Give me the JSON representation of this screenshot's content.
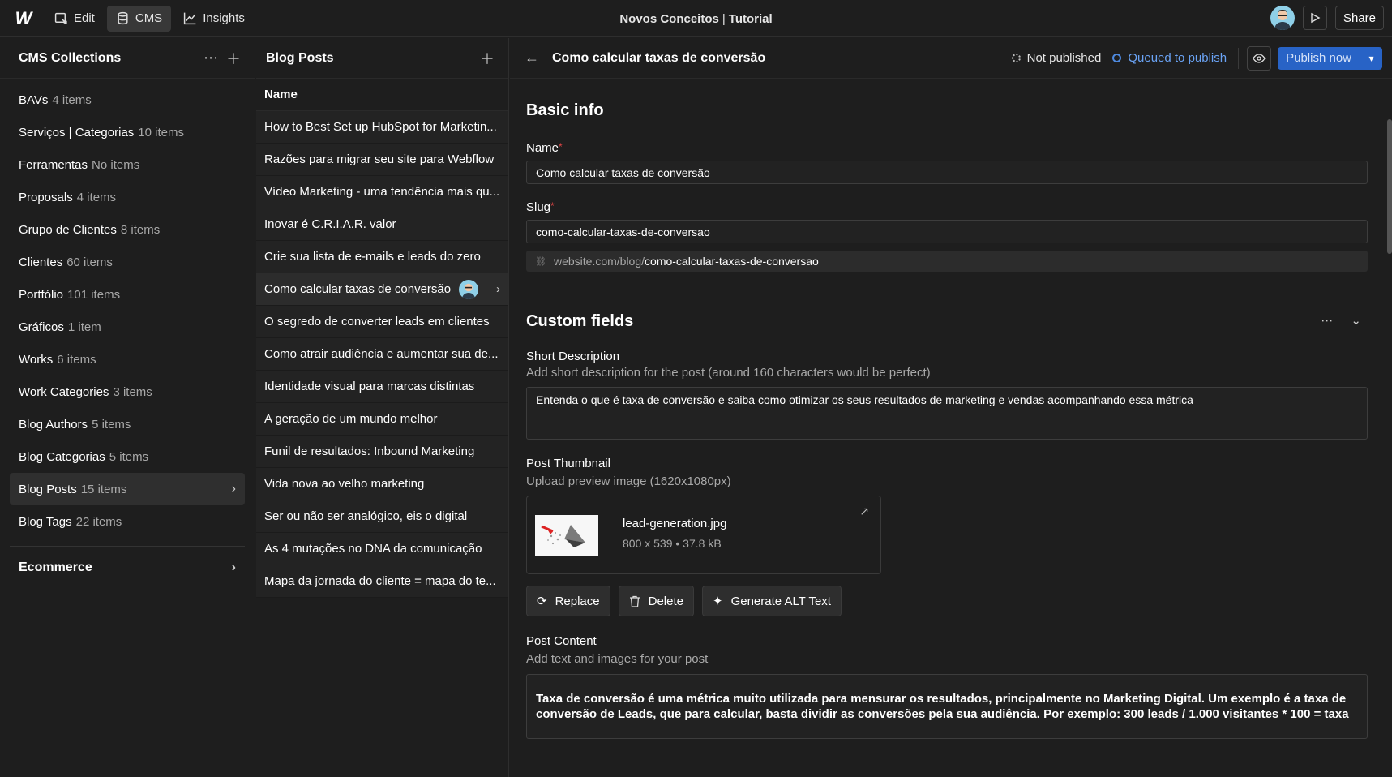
{
  "topbar": {
    "logo": "W",
    "edit_label": "Edit",
    "cms_label": "CMS",
    "insights_label": "Insights",
    "site_name": "Novos Conceitos",
    "separator": "|",
    "page_name": "Tutorial",
    "share_label": "Share"
  },
  "collections": {
    "title": "CMS Collections",
    "items": [
      {
        "name": "BAVs",
        "count": "4 items"
      },
      {
        "name": "Serviços | Categorias",
        "count": "10 items"
      },
      {
        "name": "Ferramentas",
        "count": "No items"
      },
      {
        "name": "Proposals",
        "count": "4 items"
      },
      {
        "name": "Grupo de Clientes",
        "count": "8 items"
      },
      {
        "name": "Clientes",
        "count": "60 items"
      },
      {
        "name": "Portfólio",
        "count": "101 items"
      },
      {
        "name": "Gráficos",
        "count": "1 item"
      },
      {
        "name": "Works",
        "count": "6 items"
      },
      {
        "name": "Work Categories",
        "count": "3 items"
      },
      {
        "name": "Blog Authors",
        "count": "5 items"
      },
      {
        "name": "Blog Categorias",
        "count": "5 items"
      },
      {
        "name": "Blog Posts",
        "count": "15 items"
      },
      {
        "name": "Blog Tags",
        "count": "22 items"
      }
    ],
    "ecommerce_label": "Ecommerce"
  },
  "posts": {
    "title": "Blog Posts",
    "column_header": "Name",
    "items": [
      "How to Best Set up HubSpot for Marketin...",
      "Razões para migrar seu site para Webflow",
      "Vídeo Marketing - uma tendência mais qu...",
      "Inovar é C.R.I.A.R. valor",
      "Crie sua lista de e-mails e leads do zero",
      "Como calcular taxas de conversão",
      "O segredo de converter leads em clientes",
      "Como atrair audiência e aumentar sua de...",
      "Identidade visual para marcas distintas",
      "A geração de um mundo melhor",
      "Funil de resultados: Inbound Marketing",
      "Vida nova ao velho marketing",
      "Ser ou não ser analógico, eis o digital",
      "As 4 mutações no DNA da comunicação",
      "Mapa da jornada do cliente = mapa do te..."
    ]
  },
  "editor": {
    "title": "Como calcular taxas de conversão",
    "status_not_published": "Not published",
    "status_queued": "Queued to publish",
    "publish_label": "Publish now",
    "basic_info": {
      "heading": "Basic info",
      "name_label": "Name",
      "name_value": "Como calcular taxas de conversão",
      "slug_label": "Slug",
      "slug_value": "como-calcular-taxas-de-conversao",
      "url_base": "website.com/blog/",
      "url_slug": "como-calcular-taxas-de-conversao",
      "required_mark": "*"
    },
    "custom_fields": {
      "heading": "Custom fields",
      "short_desc_label": "Short Description",
      "short_desc_help": "Add short description for the post (around 160 characters would be perfect)",
      "short_desc_value": "Entenda o que é taxa de conversão e saiba como otimizar os seus resultados de marketing e vendas acompanhando essa métrica",
      "thumb_label": "Post Thumbnail",
      "thumb_help": "Upload preview image (1620x1080px)",
      "thumb_filename": "lead-generation.jpg",
      "thumb_meta": "800 x 539 • 37.8 kB",
      "replace_label": "Replace",
      "delete_label": "Delete",
      "alt_label": "Generate ALT Text",
      "content_label": "Post Content",
      "content_help": "Add text and images for your post",
      "content_value": "Taxa de conversão é uma métrica muito utilizada para mensurar os resultados, principalmente no Marketing Digital. Um exemplo é a taxa de conversão de Leads, que para calcular, basta dividir as conversões pela sua audiência. Por exemplo: 300 leads / 1.000 visitantes * 100 = taxa"
    }
  },
  "colors": {
    "accent": "#2863c6",
    "queued": "#6aa3f5",
    "required": "#e04545"
  }
}
